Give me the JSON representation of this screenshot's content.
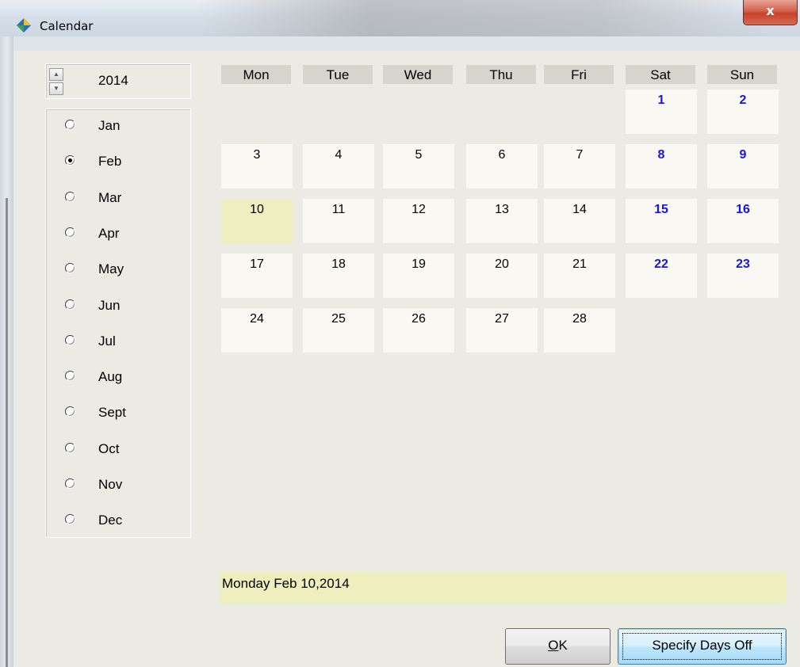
{
  "window": {
    "title": "Calendar",
    "close_label": "x"
  },
  "year": {
    "value": "2014"
  },
  "months": [
    {
      "label": "Jan",
      "checked": false
    },
    {
      "label": "Feb",
      "checked": true
    },
    {
      "label": "Mar",
      "checked": false
    },
    {
      "label": "Apr",
      "checked": false
    },
    {
      "label": "May",
      "checked": false
    },
    {
      "label": "Jun",
      "checked": false
    },
    {
      "label": "Jul",
      "checked": false
    },
    {
      "label": "Aug",
      "checked": false
    },
    {
      "label": "Sept",
      "checked": false
    },
    {
      "label": "Oct",
      "checked": false
    },
    {
      "label": "Nov",
      "checked": false
    },
    {
      "label": "Dec",
      "checked": false
    }
  ],
  "calendar": {
    "weekdays": [
      "Mon",
      "Tue",
      "Wed",
      "Thu",
      "Fri",
      "Sat",
      "Sun"
    ],
    "weeks": [
      [
        "",
        "",
        "",
        "",
        "",
        "1",
        "2"
      ],
      [
        "3",
        "4",
        "5",
        "6",
        "7",
        "8",
        "9"
      ],
      [
        "10",
        "11",
        "12",
        "13",
        "14",
        "15",
        "16"
      ],
      [
        "17",
        "18",
        "19",
        "20",
        "21",
        "22",
        "23"
      ],
      [
        "24",
        "25",
        "26",
        "27",
        "28",
        "",
        ""
      ]
    ],
    "selected_day": "10",
    "weekend_color": "#1515e6",
    "selected_color": "#eeeec0"
  },
  "status": {
    "text": "Monday Feb 10,2014"
  },
  "buttons": {
    "ok_prefix": "",
    "ok_underlined": "O",
    "ok_rest": "K",
    "specify_days_off": "Specify Days Off"
  }
}
